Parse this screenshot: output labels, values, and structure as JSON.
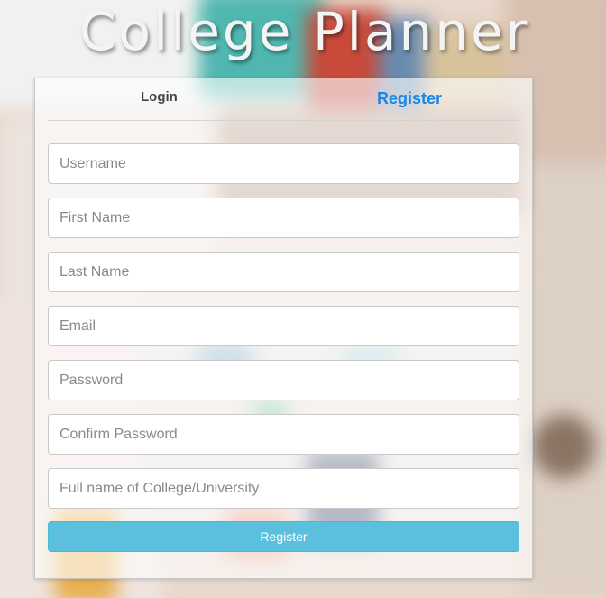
{
  "app": {
    "title": "College Planner"
  },
  "tabs": {
    "login_label": "Login",
    "register_label": "Register",
    "active": "register"
  },
  "form": {
    "fields": [
      {
        "name": "username",
        "placeholder": "Username",
        "value": ""
      },
      {
        "name": "first_name",
        "placeholder": "First Name",
        "value": ""
      },
      {
        "name": "last_name",
        "placeholder": "Last Name",
        "value": ""
      },
      {
        "name": "email",
        "placeholder": "Email",
        "value": ""
      },
      {
        "name": "password",
        "placeholder": "Password",
        "value": ""
      },
      {
        "name": "confirm_password",
        "placeholder": "Confirm Password",
        "value": ""
      },
      {
        "name": "college",
        "placeholder": "Full name of College/University",
        "value": ""
      }
    ],
    "submit_label": "Register"
  },
  "colors": {
    "active_tab": "#1a87e6",
    "inactive_tab": "#444444",
    "submit_button": "#5bc0de"
  }
}
